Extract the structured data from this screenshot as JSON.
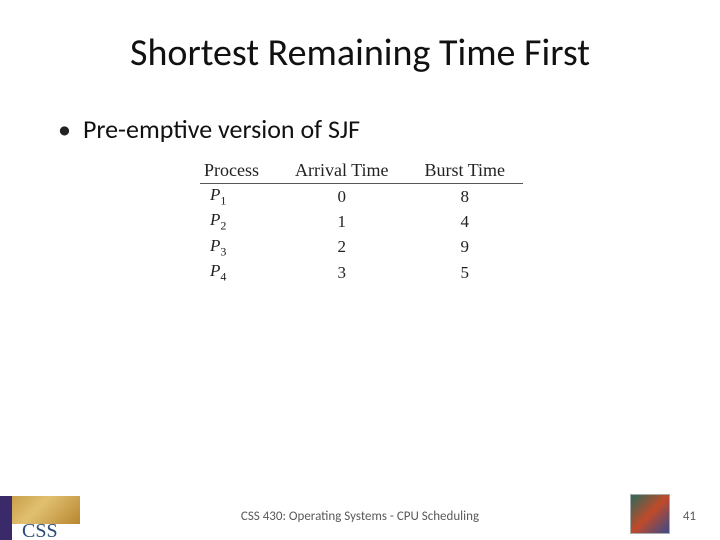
{
  "title": "Shortest Remaining Time First",
  "bullet": "Pre-emptive version of SJF",
  "chart_data": {
    "type": "table",
    "headers": [
      "Process",
      "Arrival Time",
      "Burst Time"
    ],
    "rows": [
      {
        "process": "P1",
        "p_base": "P",
        "p_sub": "1",
        "arrival": "0",
        "burst": "8"
      },
      {
        "process": "P2",
        "p_base": "P",
        "p_sub": "2",
        "arrival": "1",
        "burst": "4"
      },
      {
        "process": "P3",
        "p_base": "P",
        "p_sub": "3",
        "arrival": "2",
        "burst": "9"
      },
      {
        "process": "P4",
        "p_base": "P",
        "p_sub": "4",
        "arrival": "3",
        "burst": "5"
      }
    ]
  },
  "footer": "CSS 430: Operating Systems - CPU Scheduling",
  "page": "41",
  "logo_left": "CSS"
}
